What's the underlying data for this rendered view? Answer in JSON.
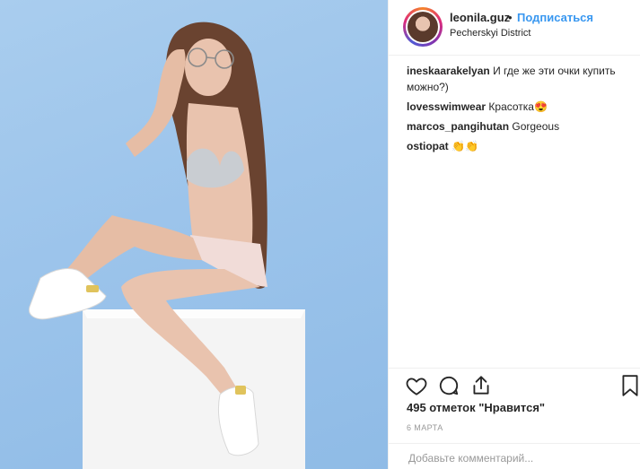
{
  "post": {
    "username": "leonila.guz",
    "separator": "•",
    "follow_label": "Подписаться",
    "location": "Pecherskyi District",
    "likes": "495 отметок \"Нравится\"",
    "date": "6 МАРТА",
    "comment_placeholder": "Добавьте комментарий..."
  },
  "comments": [
    {
      "author": "ineskaarakelyan",
      "text": "И где же эти очки купить можно?)"
    },
    {
      "author": "lovesswimwear",
      "text": "Красотка😍"
    },
    {
      "author": "marcos_pangihutan",
      "text": "Gorgeous"
    },
    {
      "author": "ostiopat",
      "text": "👏👏"
    }
  ],
  "icons": {
    "like": "heart-icon",
    "comment": "comment-icon",
    "share": "share-icon",
    "save": "bookmark-icon"
  },
  "colors": {
    "accent": "#3897f0",
    "photo_background": "#9cc4eb"
  }
}
